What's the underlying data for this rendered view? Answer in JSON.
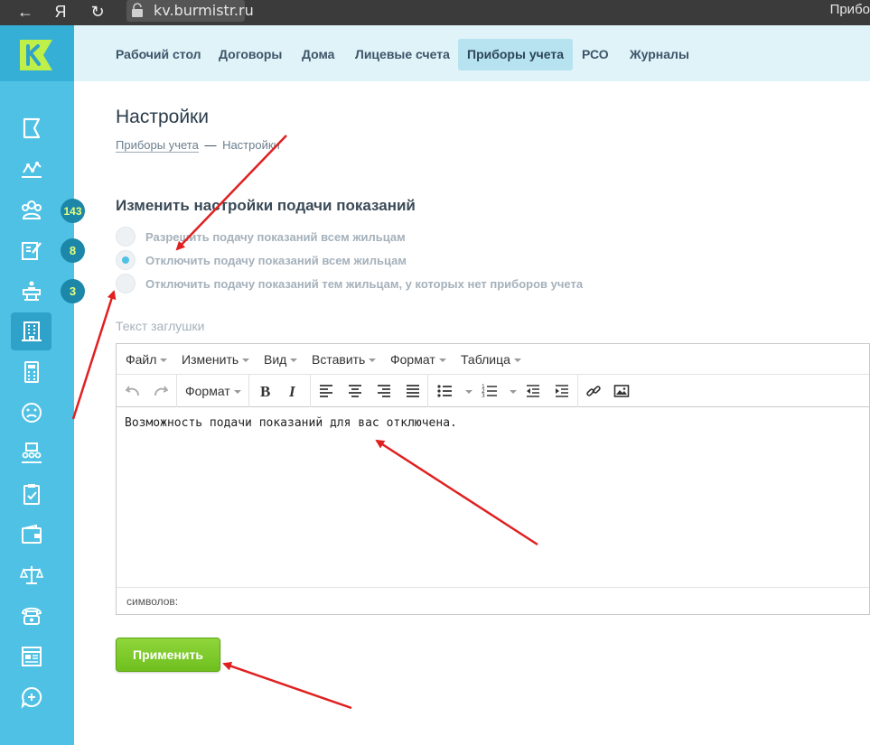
{
  "browser": {
    "back": "←",
    "yandex": "Я",
    "reload": "↻",
    "host": "kv.burmistr.ru",
    "tab_title": "Прибо"
  },
  "logo": {
    "letter": "K"
  },
  "sidebar": {
    "badges": [
      {
        "value": "143"
      },
      {
        "value": "8"
      },
      {
        "value": "3"
      }
    ]
  },
  "topnav": {
    "items": [
      {
        "label": "Рабочий стол"
      },
      {
        "label": "Договоры"
      },
      {
        "label": "Дома"
      },
      {
        "label": "Лицевые счета"
      },
      {
        "label": "Приборы учета"
      },
      {
        "label": "РСО"
      },
      {
        "label": "Журналы"
      }
    ]
  },
  "page": {
    "title": "Настройки",
    "breadcrumb_link": "Приборы учета",
    "breadcrumb_sep": "—",
    "breadcrumb_current": "Настройки"
  },
  "settings": {
    "section_title": "Изменить настройки подачи показаний",
    "options": [
      {
        "label": "Разрешить подачу показаний всем жильцам",
        "checked": false
      },
      {
        "label": "Отключить подачу показаний всем жильцам",
        "checked": true
      },
      {
        "label": "Отключить подачу показаний тем жильцам, у которых нет приборов учета",
        "checked": false
      }
    ],
    "stub_label": "Текст заглушки"
  },
  "editor": {
    "menu": [
      {
        "label": "Файл"
      },
      {
        "label": "Изменить"
      },
      {
        "label": "Вид"
      },
      {
        "label": "Вставить"
      },
      {
        "label": "Формат"
      },
      {
        "label": "Таблица"
      }
    ],
    "format_label": "Формат",
    "content": "Возможность подачи показаний для вас отключена.",
    "status": "символов:"
  },
  "apply_label": "Применить",
  "colors": {
    "sidebar": "#4ec1e4",
    "accent_green": "#7ec92a",
    "arrow_red": "#e02020"
  }
}
